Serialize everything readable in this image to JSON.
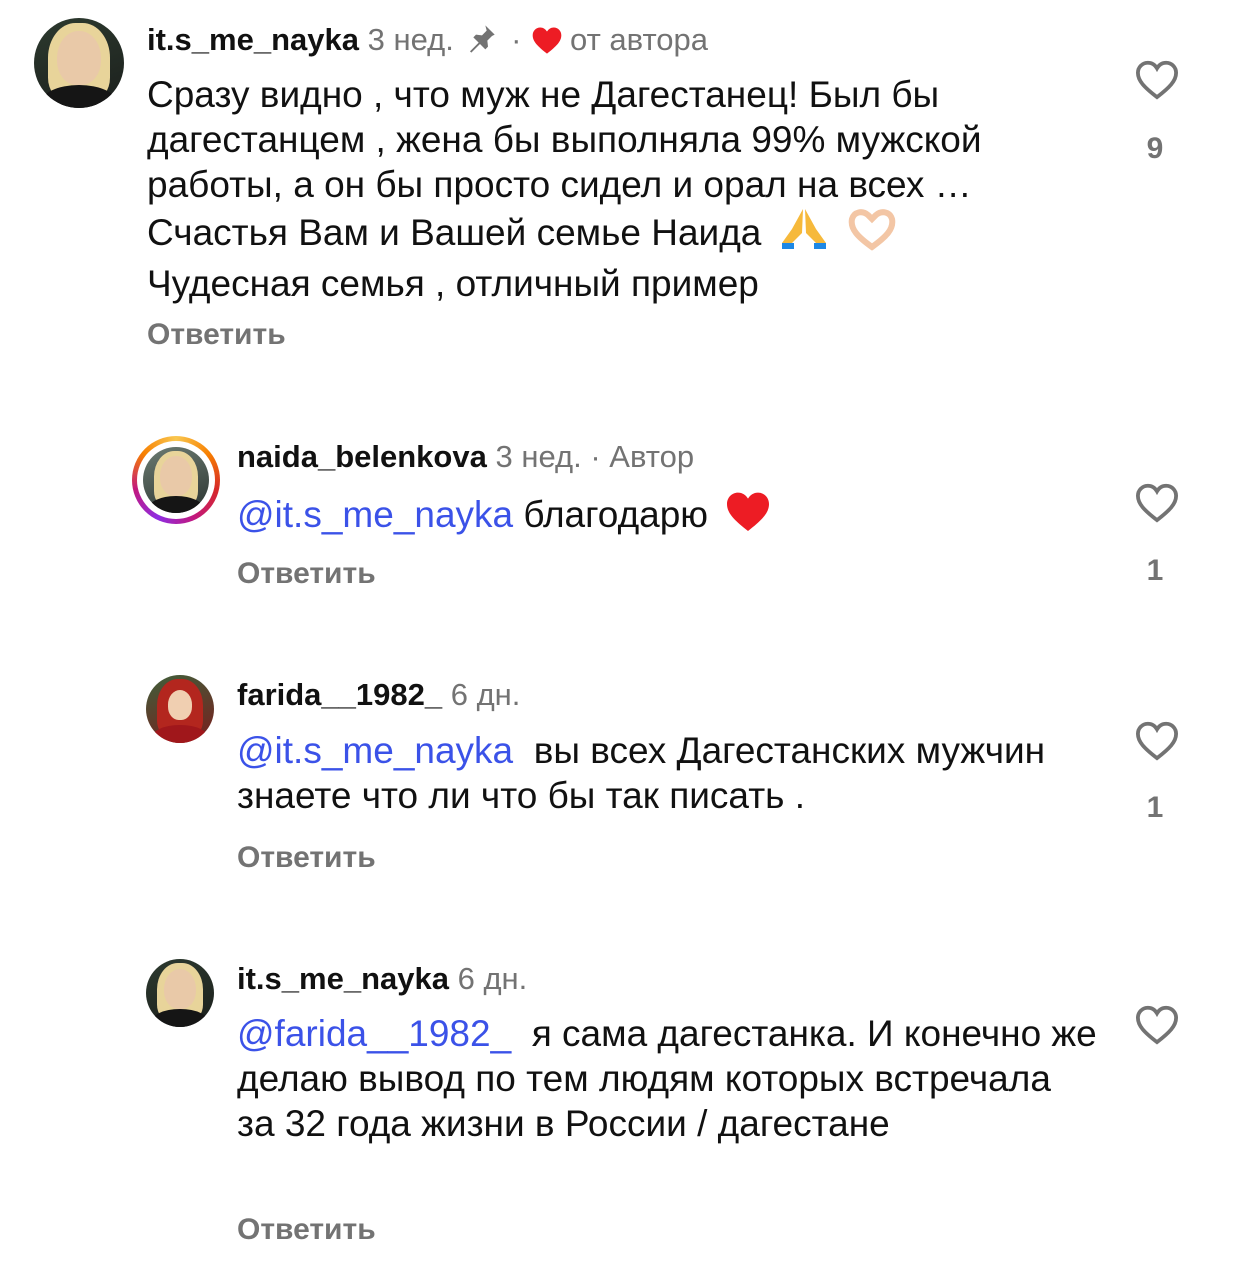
{
  "comments": [
    {
      "username": "it.s_me_nayka",
      "time": "3 нед.",
      "separator": "·",
      "liked_by_author": "от автора",
      "text": "Сразу видно , что муж не Дагестанец! Был бы дагестанцем , жена бы выполняла 99% мужской работы, а он бы просто сидел и орал на всех … Счастья Вам и Вашей семье Наида",
      "text_tail": "Чудесная семья , отличный пример",
      "emoji": [
        "folded-hands",
        "heart-hands"
      ],
      "reply_label": "Ответить",
      "like_count": "9",
      "pinned": true
    },
    {
      "username": "naida_belenkova",
      "time": "3 нед.",
      "separator": "·",
      "author_badge": "Автор",
      "mention": "@it.s_me_nayka",
      "text": "благодарю",
      "emoji": [
        "red-heart"
      ],
      "reply_label": "Ответить",
      "like_count": "1"
    },
    {
      "username": "farida__1982_",
      "time": "6 дн.",
      "mention": "@it.s_me_nayka",
      "text": "вы всех Дагестанских мужчин  знаете что ли  что бы так писать .",
      "reply_label": "Ответить",
      "like_count": "1"
    },
    {
      "username": "it.s_me_nayka",
      "time": "6 дн.",
      "mention": "@farida__1982_",
      "text": "я сама дагестанка. И конечно же делаю вывод по тем людям которых встречала за 32 года жизни в России / дагестане",
      "reply_label": "Ответить"
    }
  ],
  "colors": {
    "mention": "#3b52e8",
    "secondary_text": "#737373",
    "author_heart": "#ed1c24"
  }
}
